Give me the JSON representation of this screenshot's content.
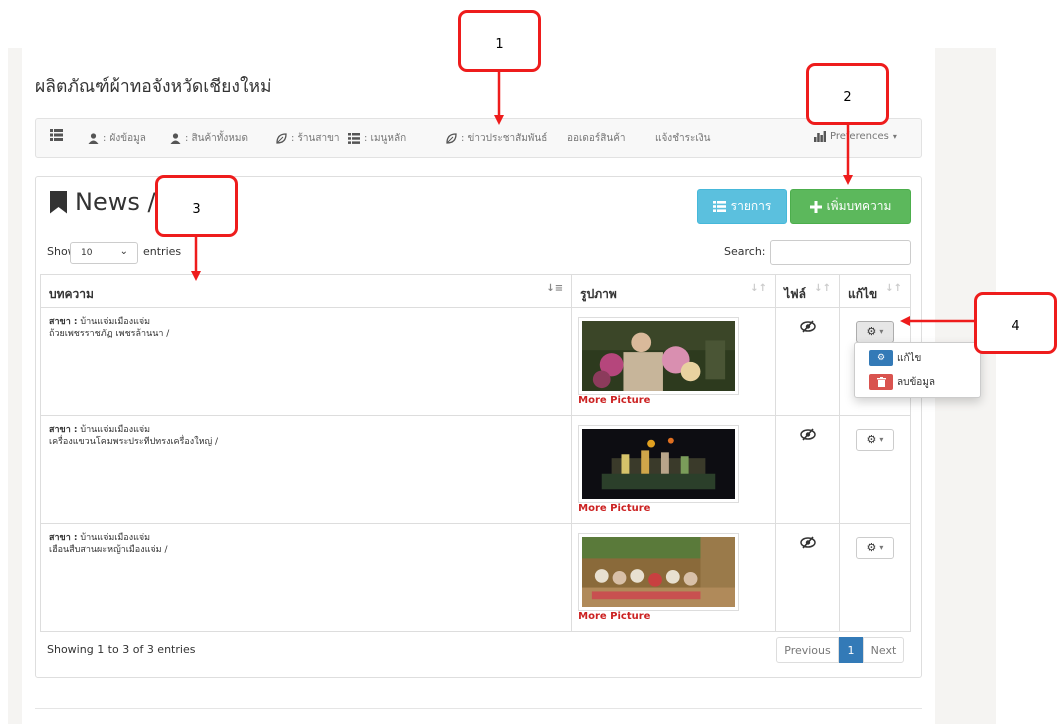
{
  "page_title": "ผลิตภัณฑ์ผ้าทอจังหวัดเชียงใหม่",
  "topnav": {
    "items": [
      {
        "label": ": ผังข้อมูล",
        "icon": "user-icon"
      },
      {
        "label": ": สินค้าทั้งหมด",
        "icon": "user-icon"
      },
      {
        "label": ": ร้านสาขา",
        "icon": "leaf-icon"
      },
      {
        "label": ": เมนูหลัก",
        "icon": "list-icon"
      },
      {
        "label": ": ข่าวประชาสัมพันธ์",
        "icon": "leaf-icon"
      },
      {
        "label": "ออเดอร์สินค้า",
        "icon": ""
      },
      {
        "label": "แจ้งชำระเงิน",
        "icon": ""
      }
    ],
    "preferences": "Preferences"
  },
  "panel": {
    "title": "News /",
    "list_button": "รายการ",
    "add_button": "เพิ่มบทความ"
  },
  "table_controls": {
    "show": "Show",
    "entries_value": "10",
    "entries": "entries",
    "search_label": "Search:",
    "search_value": ""
  },
  "table": {
    "headers": [
      "บทความ",
      "รูปภาพ",
      "ไฟล์",
      "แก้ไข"
    ],
    "rows": [
      {
        "branch_label": "สาขา :",
        "branch": "บ้านแจ่มเมืองแจ่ม",
        "text": "ถ้วยเพชรราชภัฏ เพชรล้านนา /",
        "more": "More Picture"
      },
      {
        "branch_label": "สาขา :",
        "branch": "บ้านแจ่มเมืองแจ่ม",
        "text": "เครื่องแขวนโคมพระประทีปทรงเครื่องใหญ่ /",
        "more": "More Picture"
      },
      {
        "branch_label": "สาขา :",
        "branch": "บ้านแจ่มเมืองแจ่ม",
        "text": "เฮือนสืบสานผะหญ้าเมืองแจ่ม /",
        "more": "More Picture"
      }
    ]
  },
  "dropdown": {
    "edit": "แก้ไข",
    "delete": "ลบข้อมูล"
  },
  "footer": {
    "showing": "Showing 1 to 3 of 3 entries",
    "previous": "Previous",
    "page": "1",
    "next": "Next"
  },
  "callouts": [
    "1",
    "2",
    "3",
    "4"
  ],
  "colors": {
    "callout": "#ee1c1c",
    "info": "#5bc0de",
    "success": "#5cb85c",
    "primary": "#337ab7",
    "more_picture": "#cc2222"
  }
}
